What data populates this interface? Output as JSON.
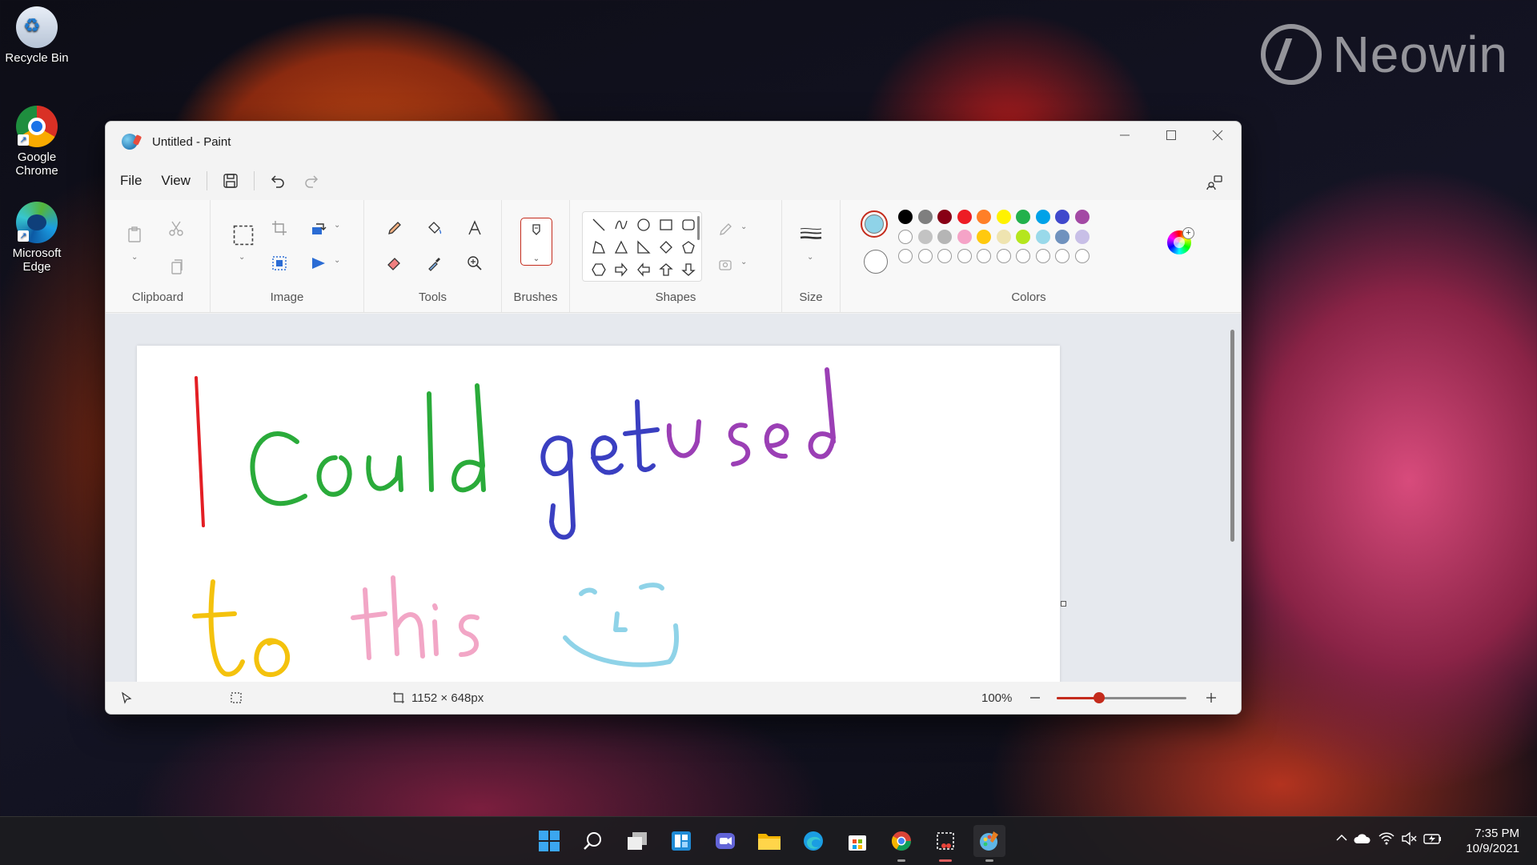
{
  "desktop": {
    "icons": [
      {
        "label": "Recycle Bin"
      },
      {
        "label_line1": "Google",
        "label_line2": "Chrome"
      },
      {
        "label_line1": "Microsoft",
        "label_line2": "Edge"
      }
    ],
    "watermark": "Neowin"
  },
  "window": {
    "title": "Untitled - Paint",
    "controls": [
      "minimize-icon",
      "maximize-icon",
      "close-icon"
    ]
  },
  "menubar": {
    "file": "File",
    "view": "View",
    "icons": [
      "save-icon",
      "undo-icon",
      "redo-icon",
      "share-icon"
    ]
  },
  "ribbon": {
    "groups": {
      "clipboard": "Clipboard",
      "image": "Image",
      "tools": "Tools",
      "brushes": "Brushes",
      "shapes": "Shapes",
      "size": "Size",
      "colors": "Colors"
    },
    "colors": {
      "primary": "#8fd3e8",
      "secondary": "#ffffff",
      "row1": [
        "#000000",
        "#7f7f7f",
        "#880015",
        "#ed1c24",
        "#ff7f27",
        "#fff200",
        "#22b14c",
        "#00a2e8",
        "#3f48cc",
        "#a349a4"
      ],
      "row2": [
        "#ffffff",
        "#c3c3c3",
        "#b5b5b5",
        "#f5a3c7",
        "#ffc90e",
        "#efe4b0",
        "#b5e61d",
        "#99d9ea",
        "#7092be",
        "#c8bfe7"
      ],
      "row3_count": 10
    }
  },
  "canvas": {
    "drawing_text": [
      {
        "text": "I",
        "color": "#e31e24"
      },
      {
        "text": "Could",
        "color": "#2aab3a"
      },
      {
        "text": "get",
        "color": "#3a3fc1"
      },
      {
        "text": "used",
        "color": "#9b3fb5"
      },
      {
        "text": "to",
        "color": "#f4c20d"
      },
      {
        "text": "this",
        "color": "#f2a6c6"
      }
    ]
  },
  "statusbar": {
    "canvas_size": "1152 × 648px",
    "zoom": "100%",
    "zoom_fraction": 0.33
  },
  "taskbar": {
    "time": "7:35 PM",
    "date": "10/9/2021",
    "apps": [
      "start-icon",
      "search-icon",
      "task-view-icon",
      "widgets-icon",
      "chat-icon",
      "file-explorer-icon",
      "edge-icon",
      "store-icon",
      "chrome-icon",
      "snipping-tool-icon",
      "paint-icon"
    ]
  }
}
